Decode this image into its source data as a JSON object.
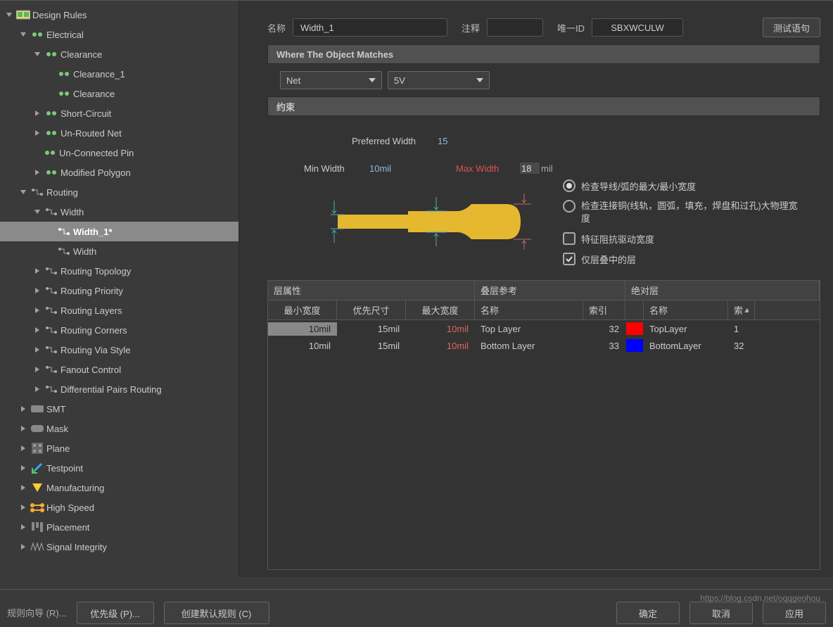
{
  "tree": {
    "root": "Design Rules",
    "electrical": "Electrical",
    "clearance": "Clearance",
    "clearance1": "Clearance_1",
    "clearance2": "Clearance",
    "short": "Short-Circuit",
    "unrouted": "Un-Routed Net",
    "unconn": "Un-Connected Pin",
    "modpoly": "Modified Polygon",
    "routing": "Routing",
    "width": "Width",
    "width1": "Width_1*",
    "width2": "Width",
    "rtopo": "Routing Topology",
    "rprio": "Routing Priority",
    "rlayers": "Routing Layers",
    "rcorners": "Routing Corners",
    "rvia": "Routing Via Style",
    "fanout": "Fanout Control",
    "diffpair": "Differential Pairs Routing",
    "smt": "SMT",
    "mask": "Mask",
    "plane": "Plane",
    "testpoint": "Testpoint",
    "mfg": "Manufacturing",
    "hspeed": "High Speed",
    "place": "Placement",
    "sig": "Signal Integrity"
  },
  "header": {
    "name_lbl": "名称",
    "name_val": "Width_1",
    "comment_lbl": "注释",
    "comment_val": "",
    "uid_lbl": "唯一ID",
    "uid_val": "SBXWCULW",
    "test_btn": "测试语句"
  },
  "sections": {
    "where": "Where The Object Matches",
    "constraints": "约束"
  },
  "query": {
    "type": "Net",
    "value": "5V"
  },
  "diagram": {
    "pref_lbl": "Preferred Width",
    "pref_val": "15",
    "min_lbl": "Min Width",
    "min_val": "10mil",
    "max_lbl": "Max Width",
    "max_val": "18",
    "max_unit": "mil"
  },
  "options": {
    "opt1": "检查导线/弧的最大/最小宽度",
    "opt2": "检查连接铜(线轨，圆弧，填充，焊盘和过孔)大物理宽度",
    "opt3": "特征阻抗驱动宽度",
    "opt4": "仅层叠中的层"
  },
  "table": {
    "g1": "层属性",
    "g2": "叠层参考",
    "g3": "绝对层",
    "h1": "最小宽度",
    "h2": "优先尺寸",
    "h3": "最大宽度",
    "h4": "名称",
    "h5": "索引",
    "h6": "名称",
    "h7": "索",
    "rows": [
      {
        "min": "10mil",
        "pref": "15mil",
        "max": "10mil",
        "name": "Top Layer",
        "idx": "32",
        "abs": "TopLayer",
        "ai": "1"
      },
      {
        "min": "10mil",
        "pref": "15mil",
        "max": "10mil",
        "name": "Bottom Layer",
        "idx": "33",
        "abs": "BottomLayer",
        "ai": "32"
      }
    ]
  },
  "footer": {
    "wizard": "规则向导 (R)...",
    "prio": "优先级 (P)...",
    "create": "创建默认规则 (C)",
    "ok": "确定",
    "cancel": "取消",
    "apply": "应用"
  },
  "watermark": "https://blog.csdn.net/oqqgeohou"
}
